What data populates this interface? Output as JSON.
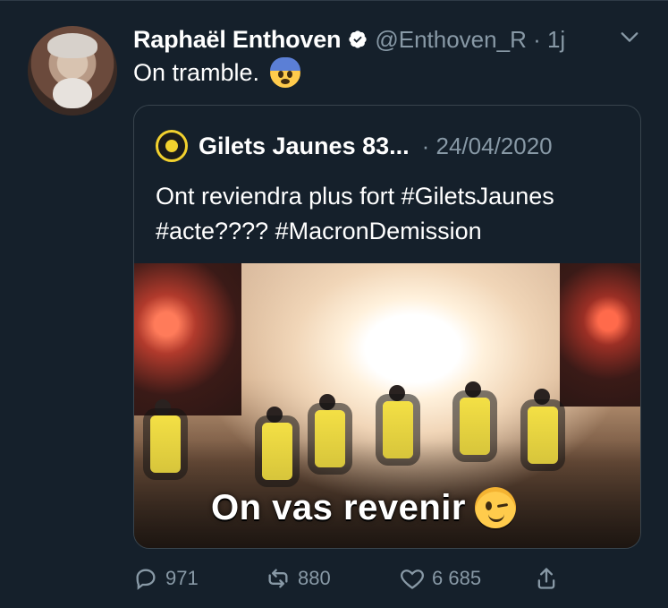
{
  "tweet": {
    "author_name": "Raphaël Enthoven",
    "handle_time": "@Enthoven_R · 1j",
    "text": "On tramble.",
    "emoji": "fearful-face",
    "verified": true
  },
  "quoted": {
    "author_name": "Gilets Jaunes 83...",
    "date": "· 24/04/2020",
    "text": "Ont reviendra plus fort #GiletsJaunes #acte???? #MacronDemission",
    "image_overlay_text": "On vas revenir",
    "overlay_emoji": "winking-face"
  },
  "actions": {
    "replies": "971",
    "retweets": "880",
    "likes": "6 685",
    "share_icon": "share-icon"
  },
  "colors": {
    "background": "#15202b",
    "text": "#ffffff",
    "secondary": "#8899a6",
    "border": "#38444d"
  }
}
